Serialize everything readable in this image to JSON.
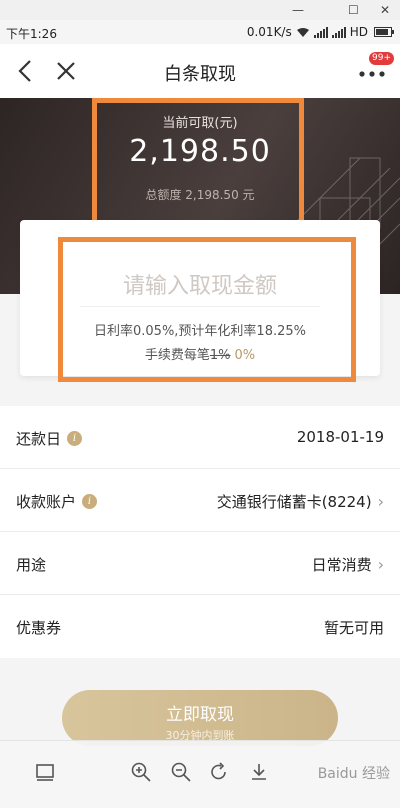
{
  "window": {
    "minimize": "—",
    "maximize": "☐",
    "close": "✕"
  },
  "status": {
    "time": "下午1:26",
    "speed": "0.01K/s",
    "network": "HD"
  },
  "nav": {
    "title": "白条取现",
    "badge": "99+"
  },
  "hero": {
    "label": "当前可取(元)",
    "amount": "2,198.50",
    "total": "总额度 2,198.50 元"
  },
  "input": {
    "placeholder": "请输入取现金额",
    "rate": "日利率0.05%,预计年化利率18.25%",
    "fee_prefix": "手续费每笔",
    "fee_old": "1%",
    "fee_new": "0%"
  },
  "rows": [
    {
      "label": "还款日",
      "value": "2018-01-19"
    },
    {
      "label": "收款账户",
      "value": "交通银行储蓄卡(8224)"
    },
    {
      "label": "用途",
      "value": "日常消费"
    },
    {
      "label": "优惠券",
      "value": "暂无可用"
    }
  ],
  "cta": {
    "label": "立即取现",
    "sub": "30分钟内到账"
  },
  "toolbar": {
    "watermark": "Baidu 经验"
  },
  "colors": {
    "highlight": "#ef8a3c",
    "gold": "#c9ad7c",
    "hero_bg": "#2d2524"
  },
  "icons": [
    "back-arrow-icon",
    "close-icon",
    "more-dots-icon",
    "info-icon",
    "chevron-right-icon",
    "layout-icon",
    "zoom-in-icon",
    "zoom-out-icon",
    "rotate-icon",
    "download-icon"
  ]
}
